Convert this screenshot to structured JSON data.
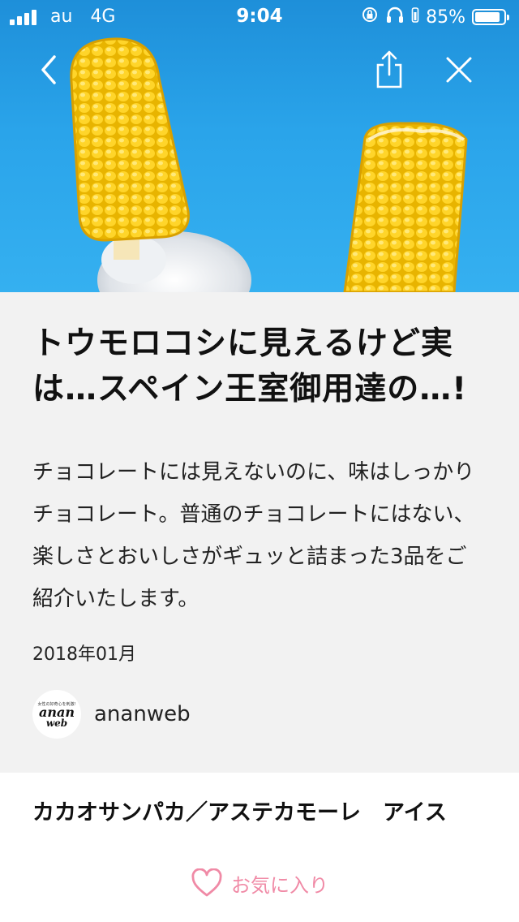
{
  "status_bar": {
    "carrier": "au",
    "network": "4G",
    "time": "9:04",
    "battery": "85%"
  },
  "nav": {
    "back_icon": "chevron-left-icon",
    "share_icon": "share-icon",
    "close_icon": "close-icon"
  },
  "article": {
    "title": "トウモロコシに見えるけど実は…スペイン王室御用達の…!",
    "lead": "チョコレートには見えないのに、味はしっかりチョコレート。普通のチョコレートにはない、楽しさとおいしさがギュッと詰まった3品をご紹介いたします。",
    "date": "2018年01月",
    "author": {
      "name": "ananweb",
      "logo_small": "女性の好奇心を刺激!",
      "logo_main": "anan",
      "logo_sub": "web"
    },
    "section_title": "カカオサンパカ／アステカモーレ　アイス"
  },
  "bottom_bar": {
    "favorite_label": "お気に入り",
    "favorite_icon": "heart-outline-icon"
  },
  "colors": {
    "hero_sky": "#2aa4ea",
    "header_bg": "#f2f2f2",
    "favorite_pink": "#f08aa6"
  }
}
